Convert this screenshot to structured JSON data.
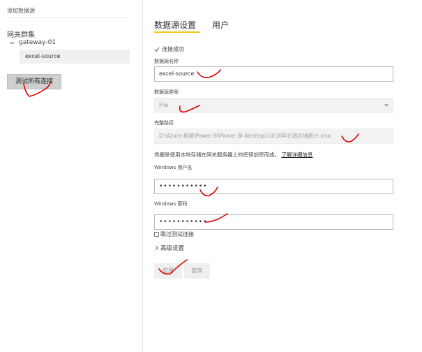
{
  "left": {
    "title": "添加数据源",
    "cluster_label": "网关群集",
    "gateway": "gateway-01",
    "source": "excel-source",
    "test_all_button": "测试所有连接"
  },
  "tabs": [
    {
      "label": "数据源设置",
      "active": true
    },
    {
      "label": "用户",
      "active": false
    }
  ],
  "form": {
    "status": "连接成功",
    "name_label": "数据源名称",
    "name_value": "excel-source",
    "type_label": "数据源类型",
    "type_value": "File",
    "path_label": "完整路径",
    "path_value": "D:\\Azure-视频\\Power BI\\Power BI desktop1\\近10年行政区域统计.xlsx",
    "info_text": "凭据是使用本地存储在网关服务器上的密钥加密而成。",
    "info_link": "了解详细信息",
    "username_label": "Windows 用户名",
    "username_value": "•••••••••••",
    "password_label": "Windows 密码",
    "password_value": "•••••••••••",
    "skip_test_label": "跳过测试连接",
    "advanced_label": "高级设置",
    "apply_button": "应用",
    "discard_button": "放弃"
  },
  "colors": {
    "tab_underline": "#f2c811",
    "annotation": "#e00000"
  }
}
